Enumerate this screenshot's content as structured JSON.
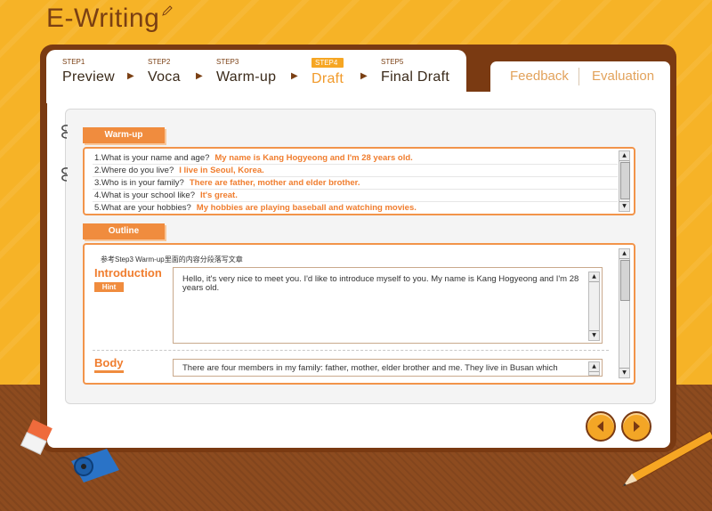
{
  "app": {
    "title": "E-Writing"
  },
  "steps": [
    {
      "num": "STEP1",
      "label": "Preview"
    },
    {
      "num": "STEP2",
      "label": "Voca"
    },
    {
      "num": "STEP3",
      "label": "Warm-up"
    },
    {
      "num": "STEP4",
      "label": "Draft"
    },
    {
      "num": "STEP5",
      "label": "Final Draft"
    }
  ],
  "active_step": "STEP4",
  "side_tabs": {
    "feedback": "Feedback",
    "evaluation": "Evaluation"
  },
  "warmup": {
    "label": "Warm-up",
    "items": [
      {
        "q": "1.What is your name and age?",
        "a": "My name is Kang Hogyeong and I'm 28 years old."
      },
      {
        "q": "2.Where do you live?",
        "a": "I live in Seoul, Korea."
      },
      {
        "q": "3.Who is in your family?",
        "a": "There are father, mother and elder brother."
      },
      {
        "q": "4.What is your school like?",
        "a": "It's great."
      },
      {
        "q": "5.What are your hobbies?",
        "a": "My hobbies are playing baseball and watching movies."
      }
    ]
  },
  "outline": {
    "label": "Outline",
    "instruction": "参考Step3 Warm-up里面的内容分段落写文章",
    "introduction": {
      "title": "Introduction",
      "hint_label": "Hint",
      "text": "Hello, it's very nice to meet you. I'd like to introduce myself to you. My name is Kang Hogyeong and I'm 28 years old."
    },
    "body": {
      "title": "Body",
      "text": "There are four members in my family: father, mother, elder brother and me. They live in Busan which"
    }
  },
  "colors": {
    "accent": "#f08c3e",
    "frame": "#7a3a12",
    "background": "#f6b327"
  },
  "icons": {
    "prev": "chevron-left-icon",
    "next": "chevron-right-icon"
  }
}
